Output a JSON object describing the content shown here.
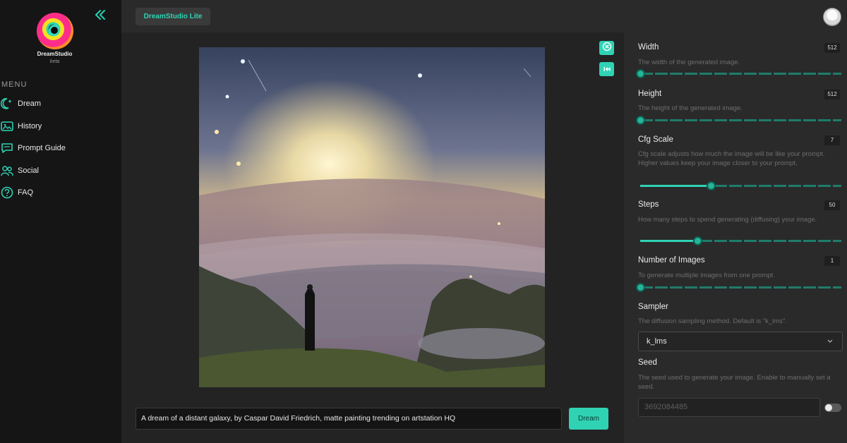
{
  "app": {
    "brand": "DreamStudio",
    "brand_sub": "beta",
    "tab_label": "DreamStudio Lite"
  },
  "sidebar": {
    "menu_title": "MENU",
    "items": [
      {
        "label": "Dream",
        "icon": "moon-stars-icon"
      },
      {
        "label": "History",
        "icon": "image-gallery-icon"
      },
      {
        "label": "Prompt Guide",
        "icon": "quote-bubble-icon"
      },
      {
        "label": "Social",
        "icon": "people-icon"
      },
      {
        "label": "FAQ",
        "icon": "question-icon"
      }
    ]
  },
  "prompt": {
    "value": "A dream of a distant galaxy, by Caspar David Friedrich, matte painting trending on artstation HQ",
    "dream_label": "Dream"
  },
  "settings": {
    "width": {
      "label": "Width",
      "value": "512",
      "desc": "The width of the generated image.",
      "fraction": 0.0
    },
    "height": {
      "label": "Height",
      "value": "512",
      "desc": "The height of the generated image.",
      "fraction": 0.0
    },
    "cfg": {
      "label": "Cfg Scale",
      "value": "7",
      "desc": "Cfg scale adjusts how much the image will be like your prompt. Higher values keep your image closer to your prompt.",
      "fraction": 0.35
    },
    "steps": {
      "label": "Steps",
      "value": "50",
      "desc": "How many steps to spend generating (diffusing) your image.",
      "fraction": 0.285
    },
    "images": {
      "label": "Number of Images",
      "value": "1",
      "desc": "To generate multiple images from one prompt.",
      "fraction": 0.0
    },
    "sampler": {
      "label": "Sampler",
      "desc": "The diffusion sampling method. Default is \"k_lms\".",
      "selected": "k_lms"
    },
    "seed": {
      "label": "Seed",
      "desc": "The seed used to generate your image. Enable to manually set a seed.",
      "value": "3692084485"
    }
  },
  "colors": {
    "accent": "#2fd3b4",
    "panel": "#2a2a2a",
    "sidebar": "#151515"
  }
}
